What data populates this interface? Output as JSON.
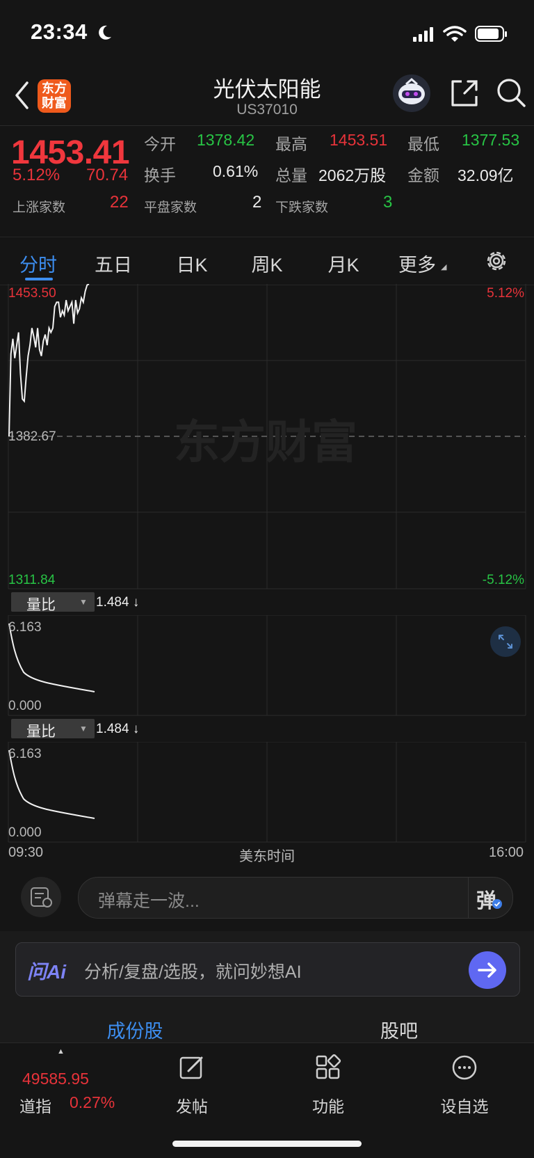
{
  "status_bar": {
    "time": "23:34"
  },
  "header": {
    "logo_text_1": "东方",
    "logo_text_2": "财富",
    "title": "光伏太阳能",
    "subtitle": "US37010"
  },
  "quote": {
    "price": "1453.41",
    "change_pct": "5.12%",
    "change_amt": "70.74",
    "rise_label": "上涨家数",
    "rise_count": "22",
    "flat_label": "平盘家数",
    "flat_count": "2",
    "fall_label": "下跌家数",
    "fall_count": "3",
    "open_label": "今开",
    "open_value": "1378.42",
    "high_label": "最高",
    "high_value": "1453.51",
    "low_label": "最低",
    "low_value": "1377.53",
    "turnover_label": "换手",
    "turnover_value": "0.61%",
    "volume_label": "总量",
    "volume_value": "2062万股",
    "amount_label": "金额",
    "amount_value": "32.09亿"
  },
  "tabs": [
    {
      "label": "分时",
      "active": true
    },
    {
      "label": "五日"
    },
    {
      "label": "日K"
    },
    {
      "label": "周K"
    },
    {
      "label": "月K"
    },
    {
      "label": "更多"
    }
  ],
  "price_chart": {
    "top_price": "1453.50",
    "mid_price": "1382.67",
    "bottom_price": "1311.84",
    "top_pct": "5.12%",
    "bottom_pct": "-5.12%",
    "watermark": "东方财富"
  },
  "indicator_1": {
    "selector": "量比",
    "value": "1.484 ↓",
    "max": "6.163",
    "min": "0.000"
  },
  "indicator_2": {
    "selector": "量比",
    "value": "1.484 ↓",
    "max": "6.163",
    "min": "0.000"
  },
  "time_axis": {
    "start": "09:30",
    "middle": "美东时间",
    "end": "16:00"
  },
  "comment": {
    "placeholder": "弹幕走一波...",
    "danmu_button": "弹"
  },
  "ai": {
    "logo": "问Ai",
    "placeholder": "分析/复盘/选股，就问妙想AI"
  },
  "sub_tabs": [
    {
      "label": "成份股",
      "active": true
    },
    {
      "label": "股吧"
    }
  ],
  "bottom_nav": {
    "index_value": "49585.95",
    "index_name": "道指",
    "index_change": "0.27%",
    "items": [
      {
        "label": "发帖"
      },
      {
        "label": "功能"
      },
      {
        "label": "设自选"
      }
    ]
  },
  "chart_data": {
    "type": "line",
    "title": "",
    "xlabel": "美东时间",
    "ylabel": "",
    "x_range": [
      "09:30",
      "16:00"
    ],
    "ylim": [
      1311.84,
      1453.5
    ],
    "reference_line": 1382.67,
    "series": [
      {
        "values": [
          1382.67,
          1421,
          1428,
          1419,
          1425,
          1431,
          1412,
          1400,
          1399,
          1410,
          1420,
          1425,
          1433,
          1429,
          1424,
          1433,
          1423,
          1420,
          1427,
          1430,
          1425,
          1433,
          1431,
          1433,
          1443,
          1445,
          1445,
          1438,
          1441,
          1439,
          1446,
          1441,
          1443,
          1445,
          1435,
          1446,
          1440,
          1442,
          1447,
          1445,
          1450,
          1453,
          1453.41
        ]
      }
    ]
  }
}
